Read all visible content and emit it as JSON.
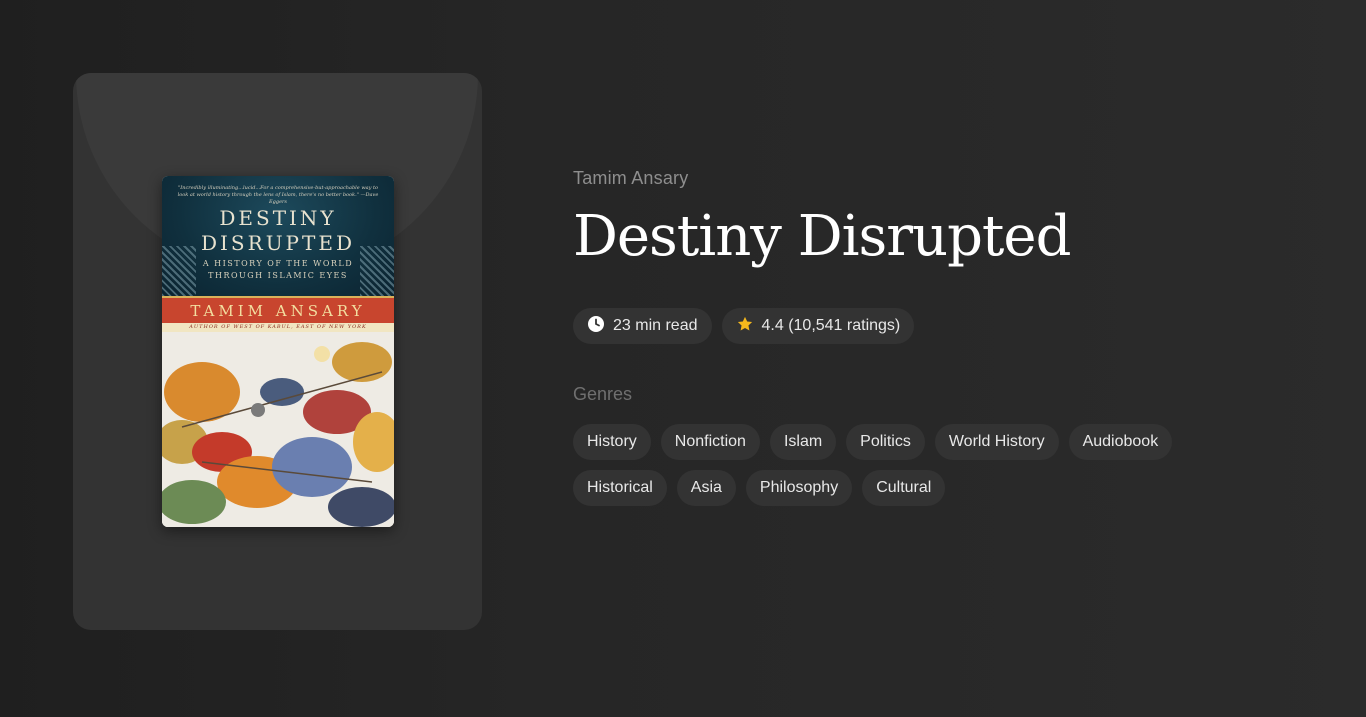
{
  "book": {
    "author": "Tamim Ansary",
    "title": "Destiny Disrupted"
  },
  "cover": {
    "blurb": "\"Incredibly illuminating...lucid...For a comprehensive-but-approachable way to look at world history through the lens of Islam, there's no better book.\" —Dave Eggers",
    "title_line1": "DESTINY",
    "title_line2": "DISRUPTED",
    "subtitle_line1": "A HISTORY OF THE WORLD",
    "subtitle_line2": "THROUGH ISLAMIC EYES",
    "author": "TAMIM ANSARY",
    "credit": "AUTHOR OF WEST OF KABUL, EAST OF NEW YORK"
  },
  "stats": {
    "read_time": "23 min read",
    "rating": "4.4 (10,541 ratings)"
  },
  "genres": {
    "label": "Genres",
    "items": [
      "History",
      "Nonfiction",
      "Islam",
      "Politics",
      "World History",
      "Audiobook",
      "Historical",
      "Asia",
      "Philosophy",
      "Cultural"
    ]
  },
  "icons": {
    "read_time": "clock-icon",
    "rating": "star-icon"
  },
  "colors": {
    "star": "#f5b81c"
  }
}
